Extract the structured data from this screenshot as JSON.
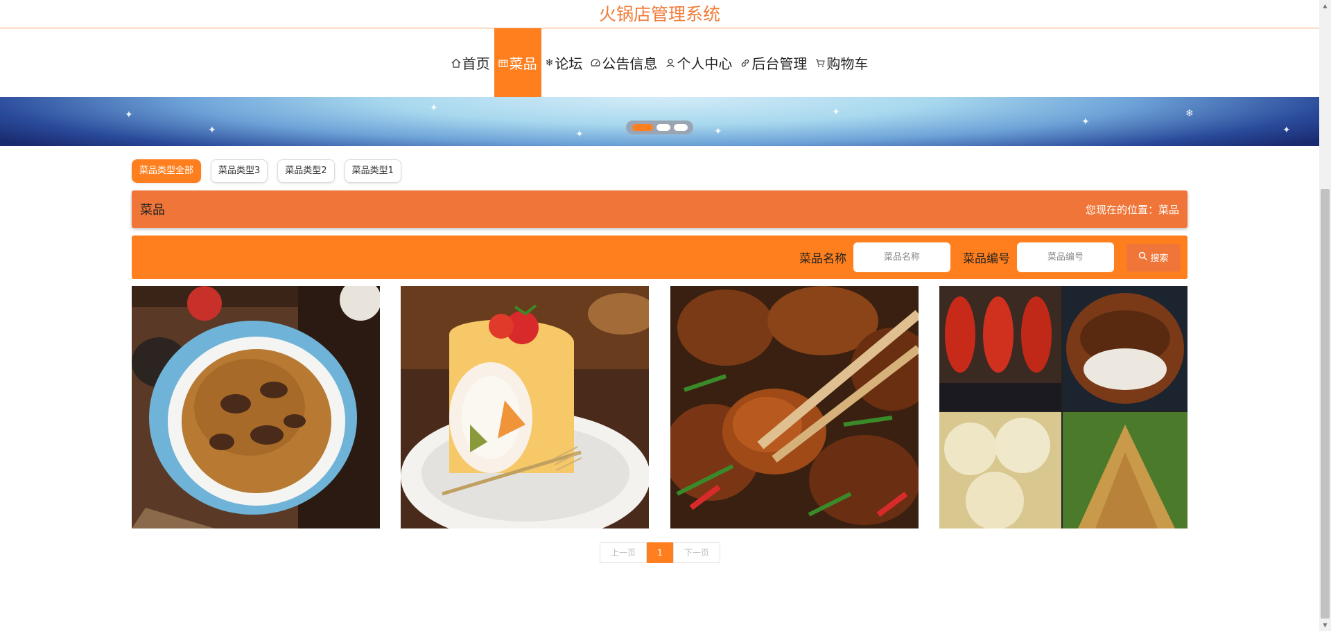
{
  "header": {
    "title": "火锅店管理系统"
  },
  "nav": {
    "items": [
      {
        "label": "首页",
        "icon": "home-icon",
        "active": false
      },
      {
        "label": "菜品",
        "icon": "menu-grid-icon",
        "active": true
      },
      {
        "label": "论坛",
        "icon": "snowflake-icon",
        "active": false
      },
      {
        "label": "公告信息",
        "icon": "gauge-icon",
        "active": false
      },
      {
        "label": "个人中心",
        "icon": "user-icon",
        "active": false
      },
      {
        "label": "后台管理",
        "icon": "link-icon",
        "active": false
      },
      {
        "label": "购物车",
        "icon": "cart-icon",
        "active": false
      }
    ]
  },
  "carousel": {
    "slide_count": 3,
    "active_index": 0
  },
  "filters": {
    "items": [
      {
        "label": "菜品类型全部",
        "active": true
      },
      {
        "label": "菜品类型3",
        "active": false
      },
      {
        "label": "菜品类型2",
        "active": false
      },
      {
        "label": "菜品类型1",
        "active": false
      }
    ]
  },
  "section": {
    "title": "菜品",
    "breadcrumb_prefix": "您现在的位置：",
    "breadcrumb_current": "菜品"
  },
  "search": {
    "name_label": "菜品名称",
    "name_placeholder": "菜品名称",
    "code_label": "菜品编号",
    "code_placeholder": "菜品编号",
    "button_label": "搜索"
  },
  "products": [
    {
      "image": "beef-noodles-photo"
    },
    {
      "image": "strawberry-cake-roll-photo"
    },
    {
      "image": "glazed-chicken-chopsticks-photo"
    },
    {
      "image": "snack-collage-photo"
    }
  ],
  "pagination": {
    "prev_label": "上一页",
    "current_page": "1",
    "next_label": "下一页"
  },
  "colors": {
    "accent": "#ff7f1e",
    "section_bar": "#f07538",
    "title": "#f07c3a"
  }
}
